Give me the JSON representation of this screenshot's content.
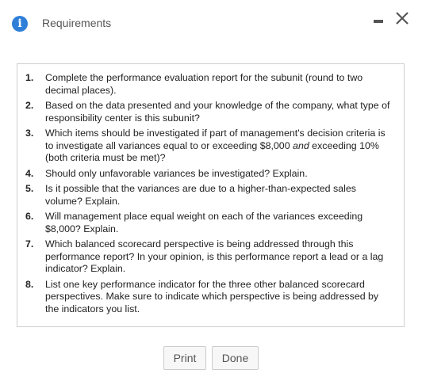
{
  "dialog": {
    "title": "Requirements",
    "info_icon": "i",
    "icons": [
      "info-icon",
      "minimize-icon",
      "close-icon"
    ],
    "accent_color": "#2f7fd8"
  },
  "requirements": [
    {
      "num": "1.",
      "text": "Complete the performance evaluation report for the subunit (round to two decimal places)."
    },
    {
      "num": "2.",
      "text": "Based on the data presented and your knowledge of the company, what type of responsibility center is this subunit?"
    },
    {
      "num": "3.",
      "text_before": "Which items should be investigated if part of management's decision criteria is to investigate all variances equal to or exceeding $8,000 ",
      "text_emph": "and",
      "text_after": " exceeding 10% (both criteria must be met)?"
    },
    {
      "num": "4.",
      "text": "Should only unfavorable variances be investigated? Explain."
    },
    {
      "num": "5.",
      "text": "Is it possible that the variances are due to a higher-than-expected sales volume? Explain."
    },
    {
      "num": "6.",
      "text": "Will management place equal weight on each of the variances exceeding $8,000? Explain."
    },
    {
      "num": "7.",
      "text": "Which balanced scorecard perspective is being addressed through this performance report? In your opinion, is this performance report a lead or a lag indicator? Explain."
    },
    {
      "num": "8.",
      "text": "List one key performance indicator for the three other balanced scorecard perspectives. Make sure to indicate which perspective is being addressed by the indicators you list."
    }
  ],
  "buttons": {
    "print": "Print",
    "done": "Done"
  }
}
